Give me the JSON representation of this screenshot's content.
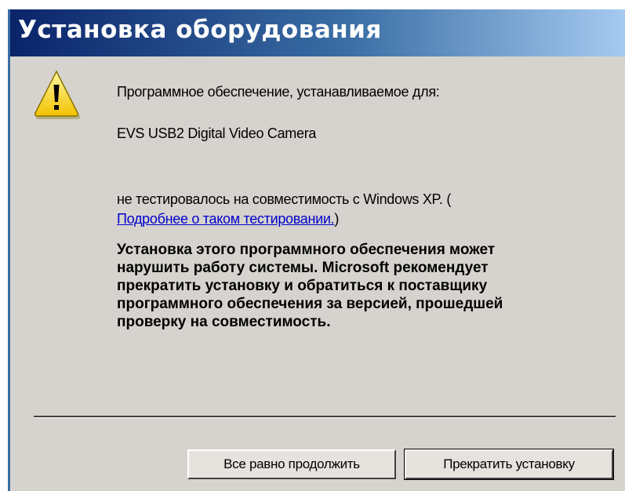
{
  "dialog": {
    "title": "Установка оборудования",
    "icon": "warning-icon",
    "accent_color": "#0a246a",
    "line1": "Программное обеспечение, устанавливаемое для:",
    "device_name": "EVS USB2 Digital Video Camera",
    "line3": "не тестировалось на совместимость с Windows XP. (",
    "link_text": "Подробнее о таком тестировании.",
    "link_close": ")",
    "warning_lines": [
      "Установка этого программного обеспечения может",
      "нарушить работу системы. Microsoft рекомендует",
      "прекратить установку и обратиться к поставщику",
      "программного обеспечения за версией, прошедшей",
      "проверку на совместимость."
    ]
  },
  "buttons": {
    "continue_label": "Все равно продолжить",
    "stop_label": "Прекратить установку"
  }
}
